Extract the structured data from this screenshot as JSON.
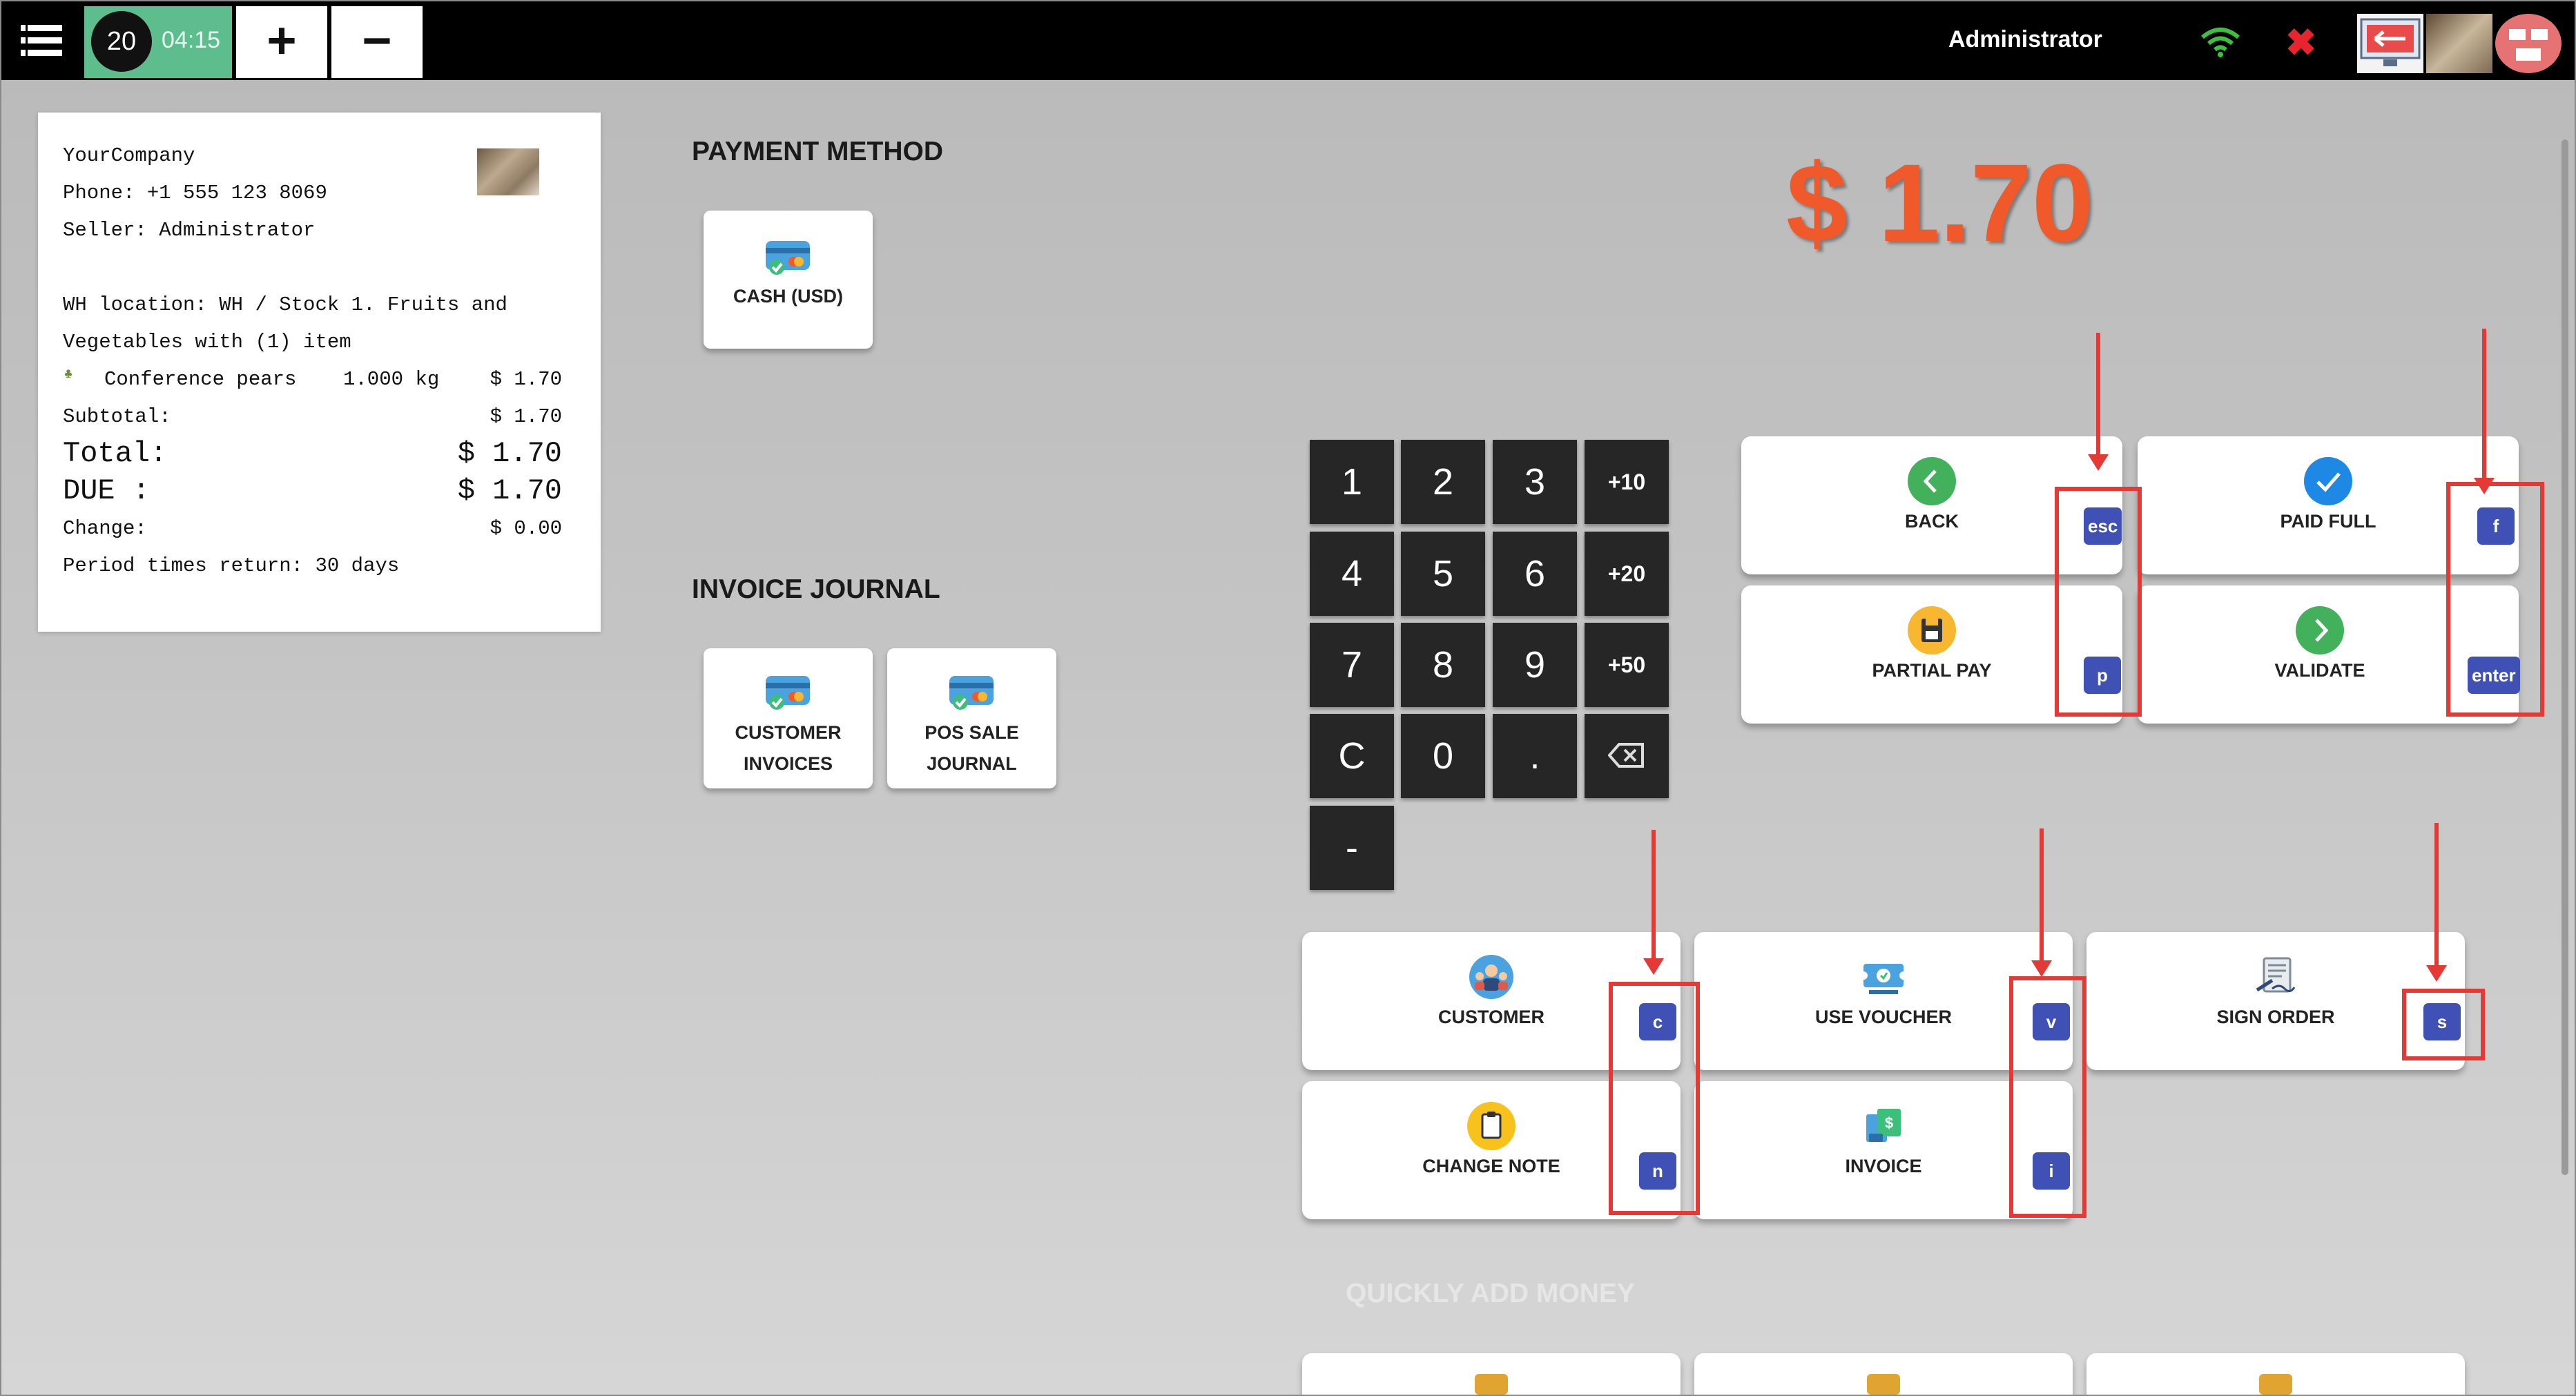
{
  "topbar": {
    "counter": "20",
    "time": "04:15",
    "plus": "+",
    "minus": "−",
    "user": "Administrator"
  },
  "receipt": {
    "company": "YourCompany",
    "phone": "Phone: +1 555 123 8069",
    "seller": "Seller: Administrator",
    "wh_line1": "WH location: WH / Stock 1. Fruits and",
    "wh_line2": "Vegetables with (1) item",
    "item_name": "Conference pears",
    "item_qty": "1.000 kg",
    "item_price": "$ 1.70",
    "subtotal_label": "Subtotal:",
    "subtotal_value": "$ 1.70",
    "total_label": "Total:",
    "total_value": "$ 1.70",
    "due_label": "DUE :",
    "due_value": "$ 1.70",
    "change_label": "Change:",
    "change_value": "$ 0.00",
    "period": "Period times return: 30 days"
  },
  "payment_method": {
    "heading": "PAYMENT METHOD",
    "cash_label": "CASH (USD)"
  },
  "invoice_journal": {
    "heading": "INVOICE JOURNAL",
    "customer_invoices_l1": "CUSTOMER",
    "customer_invoices_l2": "INVOICES",
    "pos_sale_l1": "POS SALE",
    "pos_sale_l2": "JOURNAL"
  },
  "amount_due": "$ 1.70",
  "keypad": {
    "k1": "1",
    "k2": "2",
    "k3": "3",
    "p10": "+10",
    "k4": "4",
    "k5": "5",
    "k6": "6",
    "p20": "+20",
    "k7": "7",
    "k8": "8",
    "k9": "9",
    "p50": "+50",
    "clear": "C",
    "k0": "0",
    "dot": ".",
    "minus": "-"
  },
  "actions": {
    "back": {
      "label": "BACK",
      "key": "esc"
    },
    "paid_full": {
      "label": "PAID FULL",
      "key": "f"
    },
    "partial_pay": {
      "label": "PARTIAL PAY",
      "key": "p"
    },
    "validate": {
      "label": "VALIDATE",
      "key": "enter"
    },
    "customer": {
      "label": "CUSTOMER",
      "key": "c"
    },
    "use_voucher": {
      "label": "USE VOUCHER",
      "key": "v"
    },
    "sign_order": {
      "label": "SIGN ORDER",
      "key": "s"
    },
    "change_note": {
      "label": "CHANGE NOTE",
      "key": "n"
    },
    "invoice": {
      "label": "INVOICE",
      "key": "i"
    }
  },
  "quick_add": {
    "heading": "QUICKLY ADD MONEY"
  },
  "colors": {
    "amount": "#f05a2a",
    "badge": "#3f51b5",
    "annotation": "#e53935",
    "counter": "#5dbd8d"
  }
}
